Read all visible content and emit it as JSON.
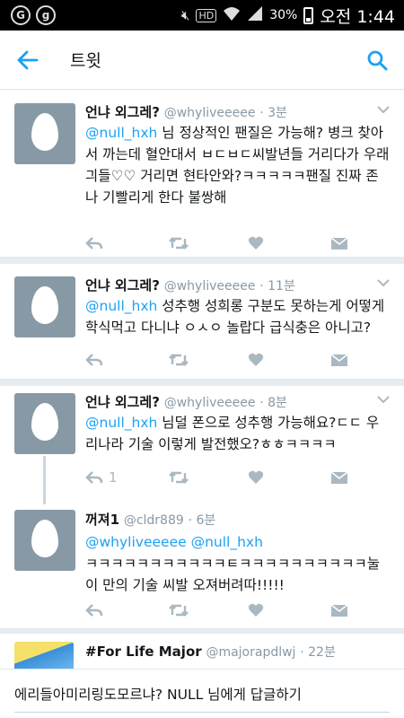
{
  "status": {
    "left_icons": [
      "G",
      "g"
    ],
    "hd": "HD",
    "battery": "30%",
    "time": "오전 1:44"
  },
  "header": {
    "title": "트윗"
  },
  "tweets": [
    {
      "name": "언냐 외그레?",
      "handle": "@whyliveeeee",
      "time": "· 3분",
      "mention": "@null_hxh",
      "text": " 님 정상적인 팬질은 가능해? 병크 찾아서 까는데 혈안대서 ㅂㄷㅂㄷ씨발년들 거리다가 우래긔들♡♡ 거리면 현타안와?ㅋㅋㅋㅋㅋ팬질 진짜 존나 기빨리게 한다 불쌍해"
    },
    {
      "name": "언냐 외그레?",
      "handle": "@whyliveeeee",
      "time": "· 11분",
      "mention": "@null_hxh",
      "text": " 성추행 성희롱 구분도 못하는게 어떻게 학식먹고 다니냐 ㅇㅅㅇ 놀랍다 급식충은 아니고?"
    },
    {
      "name": "언냐 외그레?",
      "handle": "@whyliveeeee",
      "time": "· 8분",
      "mention": "@null_hxh",
      "text": " 님덜 폰으로 성추행 가능해요?ㄷㄷ 우리나라 기술 이렇게 발전했오?ㅎㅎㅋㅋㅋㅋ",
      "reply_count": "1"
    },
    {
      "name": "꺼져1",
      "handle": "@cldr889",
      "time": "· 6분",
      "mention_line": "@whyliveeeee @null_hxh",
      "text": "ㅋㅋㅋㅋㅋㅋㅋㅋㅋㅋㅋㅌㅋㅋㅋㅋㅋㅋㅋㅋㅋㅋ눌이 만의 기술 씨발 오져버려따!!!!!"
    },
    {
      "name": "#For Life Major",
      "handle": "@majorapdlwj",
      "time": "· 22분"
    }
  ],
  "reply": {
    "placeholder": "에리들아미리링도모르냐? NULL 님에게 답글하기"
  }
}
